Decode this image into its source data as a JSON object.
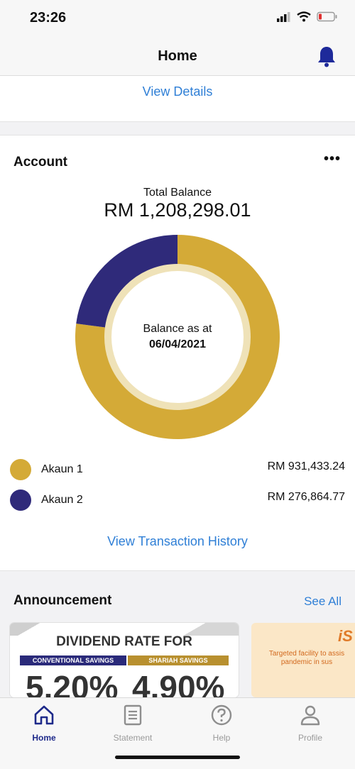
{
  "status_bar": {
    "time": "23:26"
  },
  "header": {
    "title": "Home"
  },
  "top_card": {
    "view_details": "View Details"
  },
  "account": {
    "title": "Account",
    "more": "•••",
    "total_label": "Total Balance",
    "total_value": "RM  1,208,298.01",
    "center_label": "Balance as at",
    "center_date": "06/04/2021",
    "legend": [
      {
        "name": "Akaun 1",
        "amount": "RM 931,433.24",
        "color": "#d4aa37",
        "share": 0.7709
      },
      {
        "name": "Akaun 2",
        "amount": "RM 276,864.77",
        "color": "#2f2a7a",
        "share": 0.2291
      }
    ],
    "view_history": "View Transaction History"
  },
  "announcement": {
    "title": "Announcement",
    "see_all": "See All",
    "banner1": {
      "title": "DIVIDEND RATE FOR",
      "label_a": "CONVENTIONAL SAVINGS",
      "label_b": "SHARIAH SAVINGS",
      "rate_a": "5.20%",
      "rate_b": "4.90%"
    },
    "banner2": {
      "logo": "iS",
      "text": "Targeted facility to assis pandemic in sus"
    }
  },
  "tabs": [
    {
      "label": "Home",
      "icon": "home-icon",
      "active": true
    },
    {
      "label": "Statement",
      "icon": "statement-icon",
      "active": false
    },
    {
      "label": "Help",
      "icon": "help-icon",
      "active": false
    },
    {
      "label": "Profile",
      "icon": "profile-icon",
      "active": false
    }
  ]
}
